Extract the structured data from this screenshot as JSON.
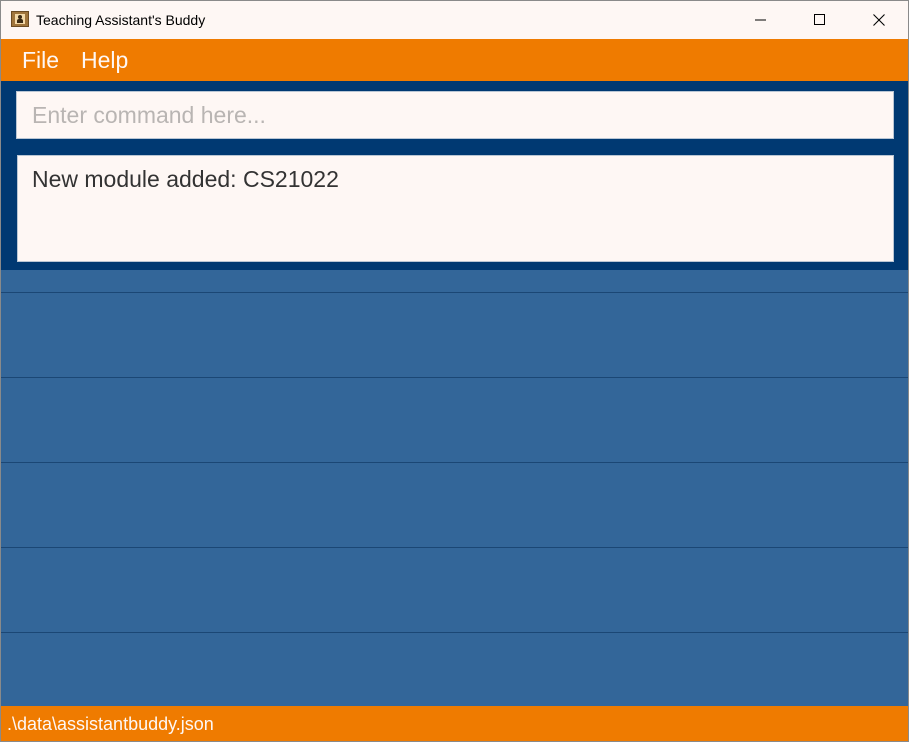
{
  "window": {
    "title": "Teaching Assistant's Buddy",
    "icons": {
      "app": "app-icon",
      "minimize": "minimize-icon",
      "maximize": "maximize-icon",
      "close": "close-icon"
    }
  },
  "menu": {
    "items": [
      {
        "label": "File"
      },
      {
        "label": "Help"
      }
    ]
  },
  "command": {
    "value": "",
    "placeholder": "Enter command here..."
  },
  "result": {
    "message": "New module added: CS21022"
  },
  "module_list": {
    "items": []
  },
  "status": {
    "file_path": ".\\data\\assistantbuddy.json"
  },
  "colors": {
    "accent_orange": "#ef7b00",
    "dark_blue": "#003972",
    "list_blue": "#336699",
    "panel_white": "#fef7f4"
  }
}
